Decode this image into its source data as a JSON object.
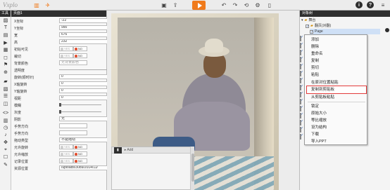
{
  "app": {
    "logo_text": "Vxplo",
    "colors": {
      "accent": "#f07a1b",
      "panel_header": "#2f2f2f",
      "highlight_border": "#e23b3b"
    }
  },
  "toolbar": {
    "left_icons": [
      "book-icon",
      "rocket-icon"
    ],
    "center_icons": [
      "save-icon",
      "export-icon",
      "play-icon",
      "undo-icon",
      "redo-icon",
      "history-icon",
      "settings-icon",
      "mobile-icon"
    ],
    "right_icons": [
      "info-icon",
      "help-icon",
      "menu-icon"
    ],
    "info_glyph": "i",
    "help_glyph": "?"
  },
  "tools": {
    "title": "工具"
  },
  "properties": {
    "title": "页面1",
    "rows": [
      {
        "label": "X坐标",
        "value": "-22"
      },
      {
        "label": "Y坐标",
        "value": "990"
      },
      {
        "label": "宽",
        "value": "676"
      },
      {
        "label": "高",
        "value": "232"
      },
      {
        "label": "初始可见",
        "yes": "YES",
        "no": "NO"
      },
      {
        "label": "裁切",
        "yes": "YES",
        "no": "NO"
      },
      {
        "label": "背景颜色",
        "placeholder": "无背景颜色"
      },
      {
        "label": "透明度"
      },
      {
        "label": "旋转(顺时针)",
        "value": "0"
      },
      {
        "label": "X轴旋转",
        "value": "0"
      },
      {
        "label": "Y轴旋转",
        "value": "0"
      },
      {
        "label": "视距",
        "value": "0"
      },
      {
        "label": "模糊"
      },
      {
        "label": "灰度"
      },
      {
        "label": "阴影",
        "value": "无"
      },
      {
        "label": "手势方向"
      },
      {
        "label": "手势方向"
      },
      {
        "label": "拖动类型",
        "value": "不能拖动"
      },
      {
        "label": "允许旋转",
        "yes": "YES",
        "no": "NO"
      },
      {
        "label": "允许缩放",
        "yes": "YES",
        "no": "NO"
      },
      {
        "label": "记录位置",
        "yes": "YES",
        "no": "NO"
      },
      {
        "label": "资源位置",
        "value": "/uploads/3089/2014/11/"
      }
    ]
  },
  "add_panel": {
    "tab_label": "",
    "add_label": "Add"
  },
  "objects": {
    "title": "对象树",
    "root_label": "舞台",
    "page_label": "翻页(对翻)",
    "item_label": "Page"
  },
  "context_menu": {
    "items": [
      {
        "label": "添加"
      },
      {
        "label": "删除"
      },
      {
        "label": "重命名"
      },
      {
        "label": "复制"
      },
      {
        "label": "剪切"
      },
      {
        "label": "粘贴"
      },
      {
        "label": "在原对位置粘贴"
      },
      {
        "label": "复制到剪贴板",
        "highlighted": true
      },
      {
        "label": "从剪贴板粘贴"
      },
      {
        "label": "锁定"
      },
      {
        "label": "原始大小"
      },
      {
        "label": "等比缩放"
      },
      {
        "label": "设为结构"
      },
      {
        "label": "下载"
      },
      {
        "label": "导入PPT"
      }
    ]
  }
}
